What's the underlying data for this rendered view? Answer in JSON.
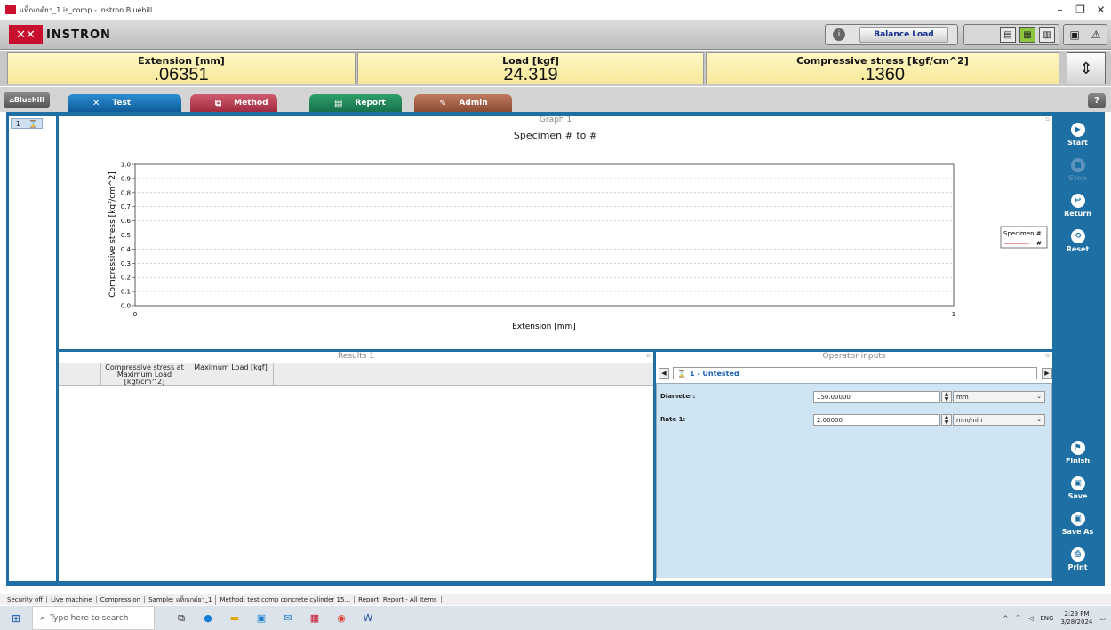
{
  "window": {
    "title": "แท็กเกต์ยา_1.is_comp - Instron Bluehill",
    "controls": [
      "–",
      "❐",
      "✕"
    ]
  },
  "brand": {
    "logo_text": "INSTRON"
  },
  "balance": {
    "label": "Balance Load",
    "info": "i"
  },
  "live": [
    {
      "label": "Extension [mm]",
      "value": ".06351"
    },
    {
      "label": "Load [kgf]",
      "value": "24.319"
    },
    {
      "label": "Compressive stress [kgf/cm^2]",
      "value": ".1360"
    }
  ],
  "tabs": {
    "home": "Bluehill",
    "test": "Test",
    "method": "Method",
    "report": "Report",
    "admin": "Admin",
    "help": "?"
  },
  "side": {
    "row_num": "1"
  },
  "graph": {
    "panel_title": "Graph 1",
    "subtitle": "Specimen # to #"
  },
  "chart_data": {
    "type": "line",
    "title": "Specimen # to #",
    "xlabel": "Extension [mm]",
    "ylabel": "Compressive stress [kgf/cm^2]",
    "xlim": [
      0,
      1
    ],
    "ylim": [
      0,
      1.0
    ],
    "xticks": [
      "0",
      "1"
    ],
    "yticks": [
      "0.0",
      "0.1",
      "0.2",
      "0.3",
      "0.4",
      "0.5",
      "0.6",
      "0.7",
      "0.8",
      "0.9",
      "1.0"
    ],
    "grid": true,
    "legend_placement": "right",
    "legend": {
      "title": "Specimen #",
      "entries": [
        "#"
      ]
    },
    "series": []
  },
  "results": {
    "panel_title": "Results 1",
    "columns": [
      "Compressive stress at Maximum Load [kgf/cm^2]",
      "Maximum Load [kgf]"
    ],
    "rows": []
  },
  "operator": {
    "panel_title": "Operator inputs",
    "specimen": "1 - Untested",
    "diameter": {
      "label": "Diameter:",
      "value": "150.00000",
      "unit": "mm"
    },
    "rate": {
      "label": "Rate 1:",
      "value": "2.00000",
      "unit": "mm/min"
    }
  },
  "actions": {
    "start": "Start",
    "stop": "Stop",
    "return": "Return",
    "reset": "Reset",
    "finish": "Finish",
    "save": "Save",
    "save_as": "Save As",
    "print": "Print"
  },
  "status": {
    "items": [
      "Security off",
      "Live machine",
      "Compression",
      "Sample: แท็กเกต์ยา_1",
      "Method: test comp concrete cylinder 15...",
      "Report: Report - All Items"
    ]
  },
  "taskbar": {
    "search_placeholder": "Type here to search",
    "lang": "ENG",
    "time": "2:29 PM",
    "date": "3/28/2024"
  }
}
